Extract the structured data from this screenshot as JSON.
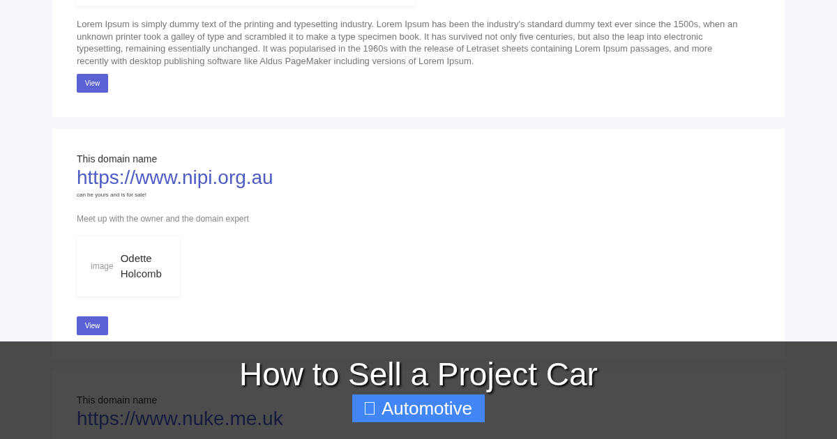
{
  "cards": [
    {
      "kind": "text",
      "body": "Lorem Ipsum is simply dummy text of the printing and typesetting industry. Lorem Ipsum has been the industry's standard dummy text ever since the 1500s, when an unknown printer took a galley of type and scrambled it to make a type specimen book. It has survived not only five centuries, but also the leap into electronic typesetting, remaining essentially unchanged. It was popularised in the 1960s with the release of Letraset sheets containing Lorem Ipsum passages, and more recently with desktop publishing software like Aldus PageMaker including versions of Lorem Ipsum.",
      "button": "View"
    },
    {
      "kind": "domain",
      "intro": "This domain name",
      "domain": "https://www.nipi.org.au",
      "tagline": "can be yours and is for sale!",
      "meet": "Meet up with the owner and the domain expert",
      "person": {
        "image_label": "image",
        "name": "Odette Holcomb"
      },
      "button": "View"
    },
    {
      "kind": "domain",
      "intro": "This domain name",
      "domain": "https://www.nuke.me.uk"
    }
  ],
  "overlay": {
    "title": "How to Sell a Project Car",
    "category": "Automotive"
  }
}
